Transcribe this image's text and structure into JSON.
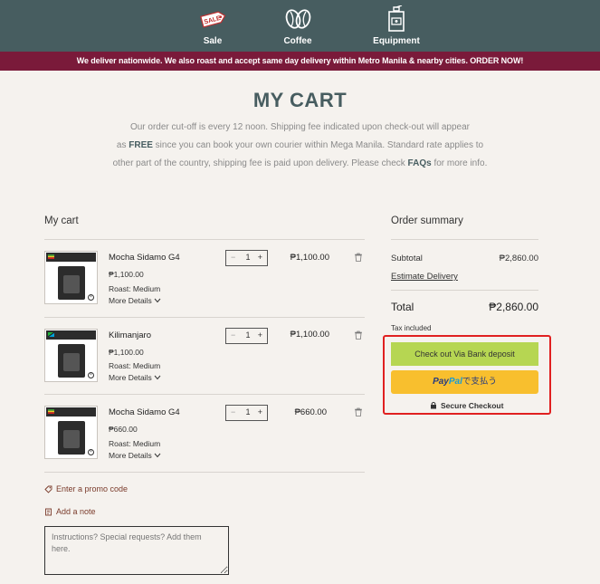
{
  "nav": {
    "items": [
      {
        "label": "Sale",
        "icon": "sale-tag-icon"
      },
      {
        "label": "Coffee",
        "icon": "coffee-beans-icon"
      },
      {
        "label": "Equipment",
        "icon": "grinder-icon"
      }
    ],
    "sale_tag_text": "SALE"
  },
  "banner": "We deliver nationwide. We also roast and accept same day delivery within Metro Manila & nearby cities. ORDER NOW!",
  "page": {
    "title": "MY CART",
    "intro_1": "Our order cut-off is every 12 noon. Shipping fee indicated upon check-out will appear",
    "intro_2a": "as ",
    "intro_2b": "FREE",
    "intro_2c": " since you can book your own courier within Mega Manila. Standard rate applies to",
    "intro_3a": "other part of the country, shipping fee is paid upon delivery. Please check ",
    "intro_3b": "FAQs",
    "intro_3c": " for more info."
  },
  "cart": {
    "title": "My cart",
    "items": [
      {
        "name": "Mocha Sidamo G4",
        "unit_price": "₱1,100.00",
        "roast": "Roast: Medium",
        "more": "More Details",
        "qty": "1",
        "total": "₱1,100.00",
        "label": "Mocha Sidamo G4"
      },
      {
        "name": "Kilimanjaro",
        "unit_price": "₱1,100.00",
        "roast": "Roast: Medium",
        "more": "More Details",
        "qty": "1",
        "total": "₱1,100.00",
        "label": "Kilimanjaro"
      },
      {
        "name": "Mocha Sidamo G4",
        "unit_price": "₱660.00",
        "roast": "Roast: Medium",
        "more": "More Details",
        "qty": "1",
        "total": "₱660.00",
        "label": "Mocha Sidamo G4"
      }
    ],
    "promo": "Enter a promo code",
    "note": "Add a note",
    "note_placeholder": "Instructions? Special requests? Add them here."
  },
  "summary": {
    "title": "Order summary",
    "subtotal_label": "Subtotal",
    "subtotal": "₱2,860.00",
    "estimate": "Estimate Delivery",
    "total_label": "Total",
    "total": "₱2,860.00",
    "tax": "Tax included",
    "bank_btn": "Check out Via Bank deposit",
    "paypal_1": "Pay",
    "paypal_2": "Pal",
    "paypal_jp": "で支払う",
    "secure": "Secure Checkout"
  },
  "colors": {
    "nav_bg": "#475d60",
    "banner_bg": "#7a1a3a",
    "bank_btn": "#b6d652",
    "paypal_btn": "#f8bf2e",
    "highlight": "#e02020"
  }
}
